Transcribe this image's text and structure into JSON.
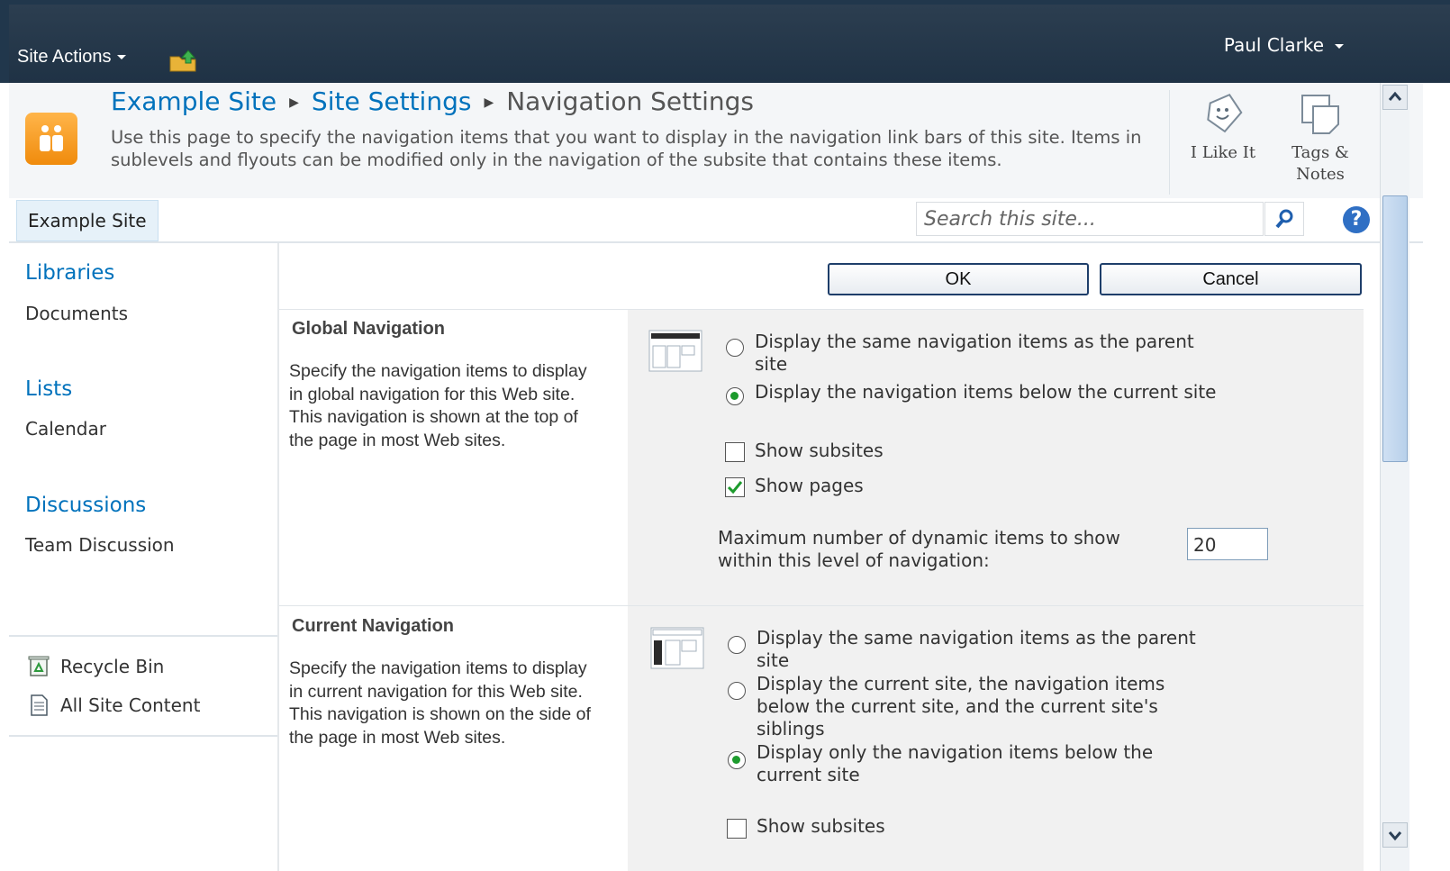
{
  "topbar": {
    "site_actions": "Site Actions",
    "user": "Paul Clarke"
  },
  "header": {
    "breadcrumb": {
      "site": "Example Site",
      "settings": "Site Settings",
      "current": "Navigation Settings"
    },
    "description": "Use this page to specify the navigation items that you want to display in the navigation link bars of this site. Items in sublevels and flyouts can be modified only in the navigation of the subsite that contains these items.",
    "ribbon": {
      "like_1": "I Like It",
      "tags_1": "Tags &",
      "tags_2": "Notes"
    }
  },
  "nav": {
    "home_tab": "Example Site",
    "search_placeholder": "Search this site..."
  },
  "quicklaunch": {
    "libraries": "Libraries",
    "documents": "Documents",
    "lists": "Lists",
    "calendar": "Calendar",
    "discussions": "Discussions",
    "team_discussion": "Team Discussion",
    "recycle_bin": "Recycle Bin",
    "all_content": "All Site Content"
  },
  "buttons": {
    "ok": "OK",
    "cancel": "Cancel"
  },
  "global_nav": {
    "title": "Global Navigation",
    "description": "Specify the navigation items to display in global navigation for this Web site. This navigation is shown at the top of the page in most Web sites.",
    "options": {
      "parent_1": "Display the same navigation items as the parent",
      "parent_2": "site",
      "below": "Display the navigation items below the current site",
      "selected": "below"
    },
    "show_subsites": "Show subsites",
    "show_subsites_checked": false,
    "show_pages": "Show pages",
    "show_pages_checked": true,
    "max_label_1": "Maximum number of dynamic items to show",
    "max_label_2": "within this level of navigation:",
    "max_value": "20"
  },
  "current_nav": {
    "title": "Current Navigation",
    "description": "Specify the navigation items to display in current navigation for this Web site. This navigation is shown on the side of the page in most Web sites.",
    "options": {
      "parent_1": "Display the same navigation items as the parent",
      "parent_2": "site",
      "siblings_1": "Display the current site, the navigation items",
      "siblings_2": "below the current site, and the current site's",
      "siblings_3": "siblings",
      "below_1": "Display only the navigation items below the",
      "below_2": "current site",
      "selected": "below"
    },
    "show_subsites": "Show subsites",
    "show_subsites_checked": false
  },
  "colors": {
    "topbar": "#21374c",
    "link": "#0072bc",
    "accent_orange": "#f08b0c",
    "radio_on": "#1d9b2d"
  }
}
